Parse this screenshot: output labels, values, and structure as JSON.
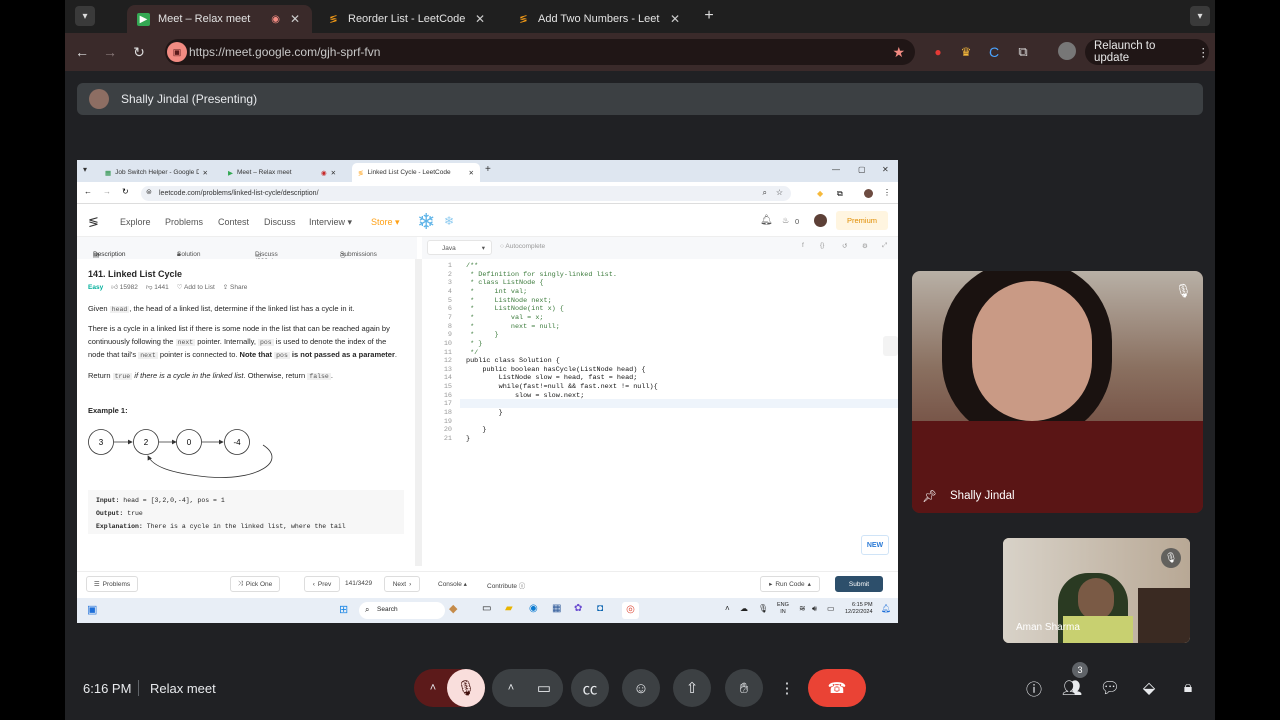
{
  "browser": {
    "tabs": [
      {
        "title": "Meet – Relax meet",
        "icon": "meet-icon"
      },
      {
        "title": "Reorder List - LeetCode",
        "icon": "leetcode-icon"
      },
      {
        "title": "Add Two Numbers - LeetCod",
        "icon": "leetcode-icon"
      }
    ],
    "new_tab": "+",
    "url": "https://meet.google.com/gjh-sprf-fvn",
    "relaunch_label": "Relaunch to update"
  },
  "meet": {
    "presenting_label": "Shally Jindal (Presenting)",
    "participant_main": "Shally Jindal",
    "participant_small": "Aman Sharma",
    "time": "6:16 PM",
    "meeting_name": "Relax meet",
    "people_count": "3"
  },
  "shared_screen": {
    "tabs": [
      "Job Switch Helper - Google Do",
      "Meet – Relax meet",
      "Linked List Cycle - LeetCode"
    ],
    "url": "leetcode.com/problems/linked-list-cycle/description/",
    "nav": [
      "Explore",
      "Problems",
      "Contest",
      "Discuss",
      "Interview ▾",
      "Store ▾"
    ],
    "streak": "0",
    "premium": "Premium",
    "subtabs": [
      "Description",
      "Solution",
      "Discuss (999+)",
      "Submissions"
    ],
    "language": "Java",
    "autocomplete": "Autocomplete",
    "problem": {
      "title": "141. Linked List Cycle",
      "difficulty": "Easy",
      "likes": "15982",
      "dislikes": "1441",
      "add_to_list": "Add to List",
      "share": "Share",
      "p1_a": "Given ",
      "p1_code": "head",
      "p1_b": ", the head of a linked list, determine if the linked list has a cycle in it.",
      "p2_a": "There is a cycle in a linked list if there is some node in the list that can be reached again by continuously following the ",
      "p2_code1": "next",
      "p2_b": " pointer. Internally, ",
      "p2_code2": "pos",
      "p2_c": " is used to denote the index of the node that tail's ",
      "p2_code3": "next",
      "p2_d": " pointer is connected to. ",
      "p2_bold1": "Note that ",
      "p2_code4": "pos",
      "p2_bold2": " is not passed as a parameter",
      "p2_end": ".",
      "p3_a": "Return ",
      "p3_code1": "true",
      "p3_ital": " if there is a cycle in the linked list",
      "p3_b": ". Otherwise, return ",
      "p3_code2": "false",
      "p3_end": ".",
      "example_title": "Example 1:",
      "nodes": [
        "3",
        "2",
        "0",
        "-4"
      ],
      "input_label": "Input:",
      "input_value": " head = [3,2,0,-4], pos = 1",
      "output_label": "Output:",
      "output_value": " true",
      "explanation_label": "Explanation:",
      "explanation_value": " There is a cycle in the linked list, where the tail"
    },
    "code_lines": [
      "/**",
      " * Definition for singly-linked list.",
      " * class ListNode {",
      " *     int val;",
      " *     ListNode next;",
      " *     ListNode(int x) {",
      " *         val = x;",
      " *         next = null;",
      " *     }",
      " * }",
      " */",
      "public class Solution {",
      "    public boolean hasCycle(ListNode head) {",
      "        ListNode slow = head, fast = head;",
      "        while(fast!=null && fast.next != null){",
      "            slow = slow.next;",
      "",
      "        }",
      "",
      "    }",
      "}"
    ],
    "new_badge": "NEW",
    "bottom": {
      "problems": "Problems",
      "pick_one": "Pick One",
      "prev": "Prev",
      "counter": "141/3429",
      "next": "Next",
      "console": "Console",
      "contribute": "Contribute",
      "run_code": "Run Code",
      "submit": "Submit"
    },
    "taskbar": {
      "search": "Search",
      "lang1": "ENG",
      "lang2": "IN",
      "time": "6:15 PM",
      "date": "12/22/2024"
    }
  },
  "colors": {
    "meet_bg": "#202124",
    "end_call": "#ea4335",
    "mic_off": "#f28b82",
    "leetcode_orange": "#ffa116",
    "submit": "#2d4f6b"
  }
}
